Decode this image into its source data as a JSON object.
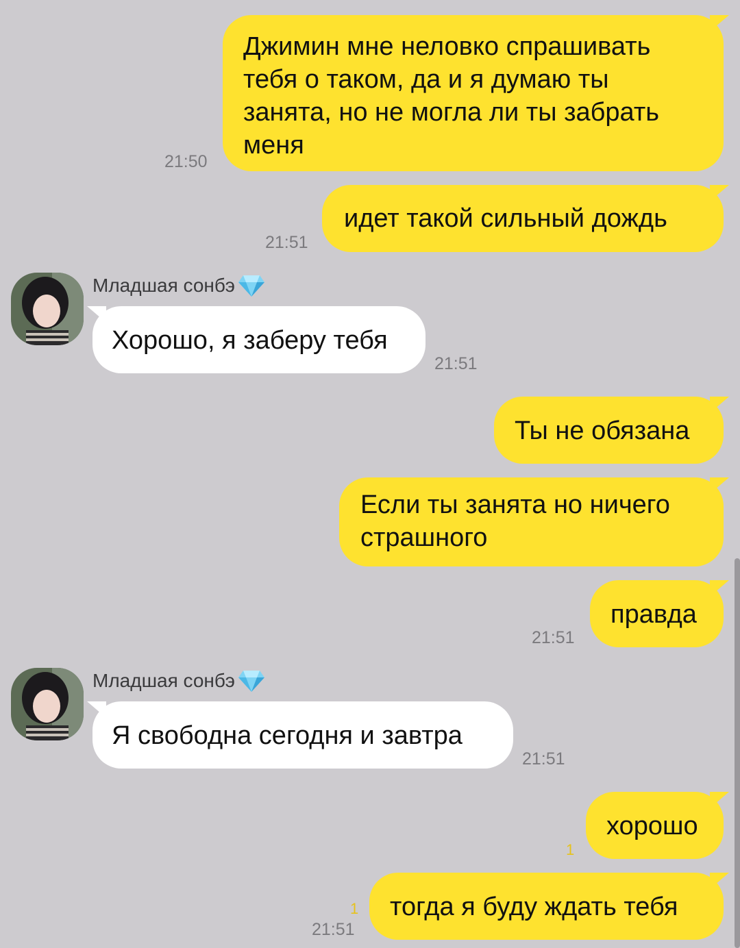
{
  "contact": {
    "name": "Младшая сонбэ",
    "badge_icon": "diamond-icon"
  },
  "messages": [
    {
      "dir": "out",
      "lines": [
        "Джимин мне неловко спрашивать",
        "тебя о таком, да и я думаю ты",
        "занята, но не могла ли ты забрать",
        "меня"
      ],
      "time": "21:50"
    },
    {
      "dir": "out",
      "lines": [
        "идет такой сильный дождь"
      ],
      "time": "21:51"
    },
    {
      "dir": "in",
      "lines": [
        "Хорошо, я заберу тебя"
      ],
      "time": "21:51"
    },
    {
      "dir": "out",
      "lines": [
        "Ты не обязана"
      ],
      "time": ""
    },
    {
      "dir": "out",
      "lines": [
        "Если ты занята но ничего",
        "страшного"
      ],
      "time": ""
    },
    {
      "dir": "out",
      "lines": [
        "правда"
      ],
      "time": "21:51"
    },
    {
      "dir": "in",
      "lines": [
        "Я свободна сегодня и завтра"
      ],
      "time": "21:51"
    },
    {
      "dir": "out",
      "lines": [
        "хорошо"
      ],
      "time": "",
      "unread": "1"
    },
    {
      "dir": "out",
      "lines": [
        "тогда я буду ждать тебя"
      ],
      "time": "21:51",
      "unread": "1"
    }
  ],
  "colors": {
    "background": "#cdcbcf",
    "outgoing": "#fee22f",
    "incoming": "#ffffff",
    "unread": "#e6c21a"
  }
}
